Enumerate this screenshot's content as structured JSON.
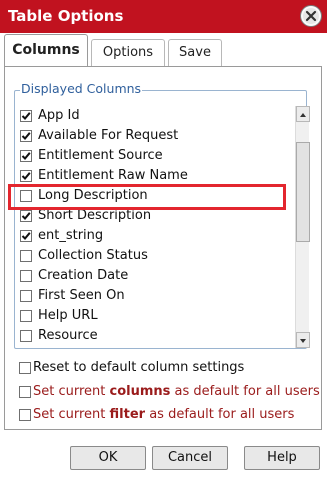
{
  "window": {
    "title": "Table Options"
  },
  "tabs": [
    {
      "label": "Columns",
      "active": true
    },
    {
      "label": "Options",
      "active": false
    },
    {
      "label": "Save",
      "active": false
    }
  ],
  "displayed_columns": {
    "legend": "Displayed Columns",
    "items": [
      {
        "label": "App Id",
        "checked": true
      },
      {
        "label": "Available For Request",
        "checked": true
      },
      {
        "label": "Entitlement Source",
        "checked": true
      },
      {
        "label": "Entitlement Raw Name",
        "checked": true
      },
      {
        "label": "Long Description",
        "checked": false
      },
      {
        "label": "Short Description",
        "checked": true
      },
      {
        "label": "ent_string",
        "checked": true
      },
      {
        "label": "Collection Status",
        "checked": false
      },
      {
        "label": "Creation Date",
        "checked": false
      },
      {
        "label": "First Seen On",
        "checked": false
      },
      {
        "label": "Help URL",
        "checked": false
      },
      {
        "label": "Resource",
        "checked": false
      }
    ]
  },
  "options": {
    "reset_label": "Reset to default column settings",
    "set_columns_prefix": "Set current ",
    "set_columns_bold": "columns",
    "set_columns_suffix": " as default for all users",
    "set_filter_prefix": "Set current ",
    "set_filter_bold": "filter",
    "set_filter_suffix": " as default for all users"
  },
  "buttons": {
    "ok": "OK",
    "cancel": "Cancel",
    "help": "Help"
  },
  "colors": {
    "titlebar": "#c1121f",
    "legend": "#2f5f9c",
    "highlight": "#e3262e",
    "red_text": "#9a1b1b"
  },
  "icons": {
    "close": "close-icon",
    "check": "check-icon"
  }
}
